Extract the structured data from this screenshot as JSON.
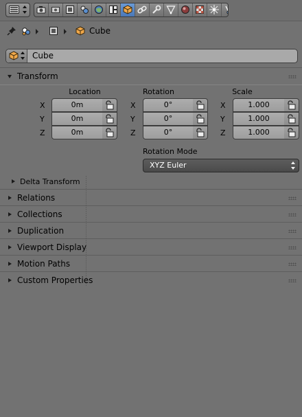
{
  "header": {
    "editor_icon": "properties-editor-icon",
    "tabs": [
      {
        "name": "render-tab",
        "icon": "camera-icon",
        "active": false
      },
      {
        "name": "render-layers-tab",
        "icon": "layers-icon",
        "active": false
      },
      {
        "name": "output-tab",
        "icon": "output-icon",
        "active": false
      },
      {
        "name": "view-layer-tab",
        "icon": "view-layer-icon",
        "active": false
      },
      {
        "name": "scene-tab",
        "icon": "scene-icon",
        "active": false
      },
      {
        "name": "world-tab",
        "icon": "world-icon",
        "active": false
      },
      {
        "name": "object-tab",
        "icon": "cube-icon",
        "active": true
      },
      {
        "name": "constraints-tab",
        "icon": "link-icon",
        "active": false
      },
      {
        "name": "modifiers-tab",
        "icon": "wrench-icon",
        "active": false
      },
      {
        "name": "data-tab",
        "icon": "mesh-data-icon",
        "active": false
      },
      {
        "name": "material-tab",
        "icon": "material-icon",
        "active": false
      },
      {
        "name": "texture-tab",
        "icon": "texture-icon",
        "active": false
      },
      {
        "name": "particles-tab",
        "icon": "particles-icon",
        "active": false
      },
      {
        "name": "physics-tab",
        "icon": "physics-icon",
        "active": false
      }
    ]
  },
  "breadcrumb": {
    "pin_icon": "pin-icon",
    "scene_icon": "scene-icon",
    "object_icon": "object-icon",
    "label": "Cube"
  },
  "object_name": "Cube",
  "transform": {
    "title": "Transform",
    "location_label": "Location",
    "rotation_label": "Rotation",
    "scale_label": "Scale",
    "axes": [
      "X",
      "Y",
      "Z"
    ],
    "location": [
      "0m",
      "0m",
      "0m"
    ],
    "rotation": [
      "0°",
      "0°",
      "0°"
    ],
    "scale": [
      "1.000",
      "1.000",
      "1.000"
    ],
    "rotation_mode_label": "Rotation Mode",
    "rotation_mode_value": "XYZ Euler",
    "delta_label": "Delta Transform"
  },
  "panels": [
    "Relations",
    "Collections",
    "Duplication",
    "Viewport Display",
    "Motion Paths",
    "Custom Properties"
  ],
  "colors": {
    "background": "#727272",
    "active_tab": "#5680c2",
    "dropdown": "#525252",
    "object_orange": "#e99a3a"
  }
}
